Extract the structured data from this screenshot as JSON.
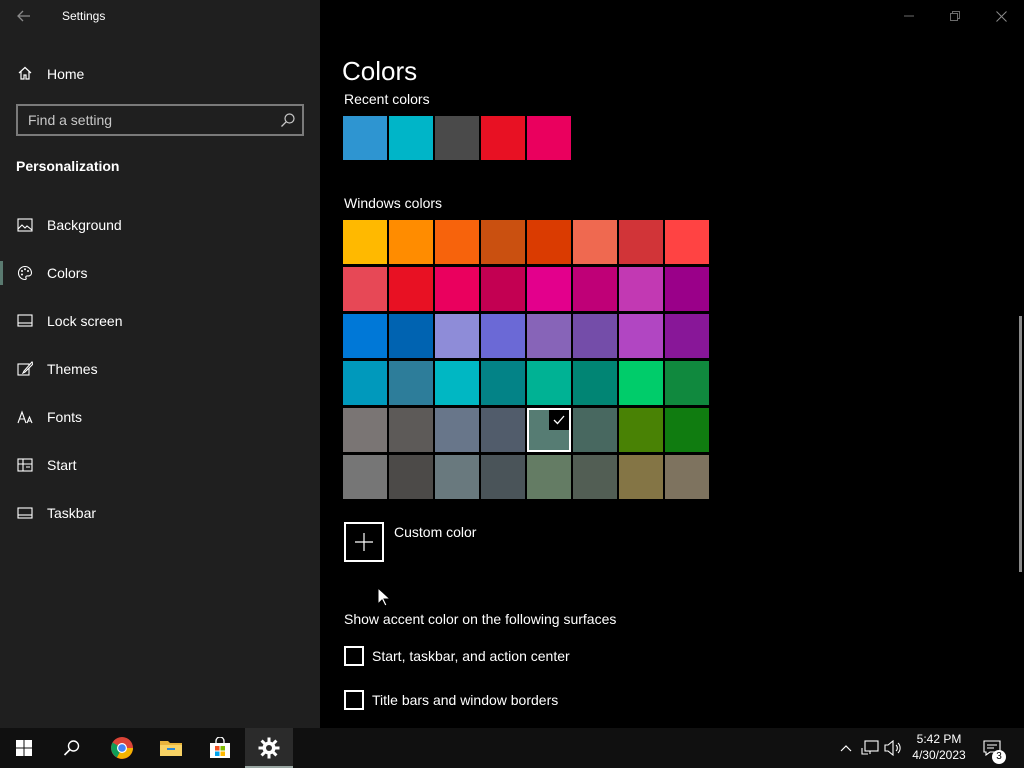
{
  "window": {
    "title": "Settings"
  },
  "sidebar": {
    "home_label": "Home",
    "search": {
      "placeholder": "Find a setting"
    },
    "section_title": "Personalization",
    "items": [
      {
        "label": "Background",
        "icon": "image-icon"
      },
      {
        "label": "Colors",
        "icon": "palette-icon",
        "selected": true
      },
      {
        "label": "Lock screen",
        "icon": "lock-screen-icon"
      },
      {
        "label": "Themes",
        "icon": "brush-icon"
      },
      {
        "label": "Fonts",
        "icon": "font-icon"
      },
      {
        "label": "Start",
        "icon": "start-icon"
      },
      {
        "label": "Taskbar",
        "icon": "taskbar-icon"
      }
    ]
  },
  "main": {
    "page_title": "Colors",
    "recent_label": "Recent colors",
    "recent_colors": [
      "#2e95d1",
      "#00b5c8",
      "#4a4a4a",
      "#e81123",
      "#ea005e"
    ],
    "windows_label": "Windows colors",
    "windows_colors": [
      [
        "#ffb900",
        "#ff8c00",
        "#f7630c",
        "#ca5010",
        "#da3b01",
        "#ef6950",
        "#d13438",
        "#ff4343"
      ],
      [
        "#e74856",
        "#e81123",
        "#ea005e",
        "#c30052",
        "#e3008c",
        "#bf0077",
        "#c239b3",
        "#9a0089"
      ],
      [
        "#0078d7",
        "#0063b1",
        "#8e8cd8",
        "#6b69d6",
        "#8764b8",
        "#744da9",
        "#b146c2",
        "#881798"
      ],
      [
        "#0099bc",
        "#2d7d9a",
        "#00b7c3",
        "#038387",
        "#00b294",
        "#018574",
        "#00cc6a",
        "#10893e"
      ],
      [
        "#7a7574",
        "#5d5a58",
        "#68768a",
        "#515c6b",
        "#567c73",
        "#486860",
        "#498205",
        "#107c10"
      ],
      [
        "#767676",
        "#4c4a48",
        "#69797e",
        "#4a5459",
        "#647c64",
        "#525e54",
        "#847545",
        "#7e735f"
      ]
    ],
    "selected_color": {
      "row": 4,
      "col": 4
    },
    "custom_color_label": "Custom color",
    "surfaces_label": "Show accent color on the following surfaces",
    "checkboxes": [
      {
        "label": "Start, taskbar, and action center",
        "checked": false
      },
      {
        "label": "Title bars and window borders",
        "checked": false
      }
    ]
  },
  "taskbar": {
    "pinned": [
      "start-icon",
      "search-icon",
      "chrome-icon",
      "file-explorer-icon",
      "store-icon",
      "settings-icon"
    ],
    "active_app": "settings-icon",
    "clock": {
      "time": "5:42 PM",
      "date": "4/30/2023"
    },
    "notifications_count": "3"
  }
}
